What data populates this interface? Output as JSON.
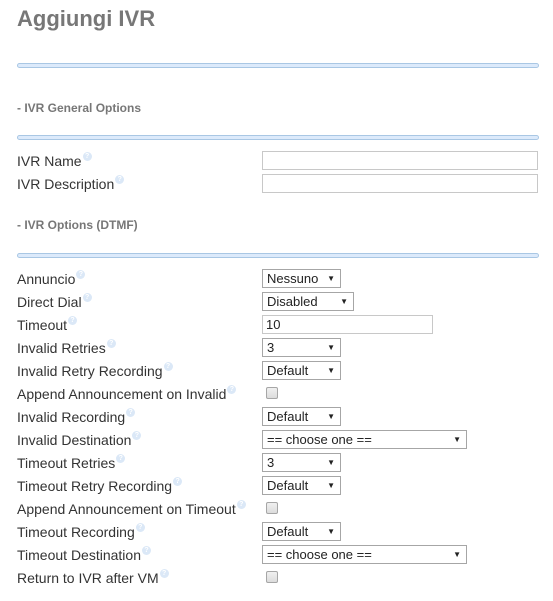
{
  "page": {
    "title": "Aggiungi IVR"
  },
  "sections": [
    {
      "title": "- IVR General Options"
    },
    {
      "title": "- IVR Options (DTMF)"
    }
  ],
  "general": {
    "ivr_name": {
      "label": "IVR Name",
      "value": "",
      "placeholder": ""
    },
    "ivr_description": {
      "label": "IVR Description",
      "value": "",
      "placeholder": ""
    }
  },
  "dtmf": {
    "annuncio": {
      "label": "Annuncio",
      "selected": "Nessuno"
    },
    "direct_dial": {
      "label": "Direct Dial",
      "selected": "Disabled"
    },
    "timeout": {
      "label": "Timeout",
      "value": "10"
    },
    "invalid_retries": {
      "label": "Invalid Retries",
      "selected": "3"
    },
    "invalid_retry_recording": {
      "label": "Invalid Retry Recording",
      "selected": "Default"
    },
    "append_announcement_invalid": {
      "label": "Append Announcement on Invalid",
      "checked": false
    },
    "invalid_recording": {
      "label": "Invalid Recording",
      "selected": "Default"
    },
    "invalid_destination": {
      "label": "Invalid Destination",
      "selected": "== choose one =="
    },
    "timeout_retries": {
      "label": "Timeout Retries",
      "selected": "3"
    },
    "timeout_retry_recording": {
      "label": "Timeout Retry Recording",
      "selected": "Default"
    },
    "append_announcement_timeout": {
      "label": "Append Announcement on Timeout",
      "checked": false
    },
    "timeout_recording": {
      "label": "Timeout Recording",
      "selected": "Default"
    },
    "timeout_destination": {
      "label": "Timeout Destination",
      "selected": "== choose one =="
    },
    "return_to_ivr_after_vm": {
      "label": "Return to IVR after VM",
      "checked": false
    }
  },
  "icons": {
    "help": "?",
    "dropdown_arrow": "▼"
  },
  "colors": {
    "title": "#777777",
    "divider_fill": "#dceafb",
    "divider_border": "#a9c7e4",
    "help_icon": "#dbe8f7"
  }
}
